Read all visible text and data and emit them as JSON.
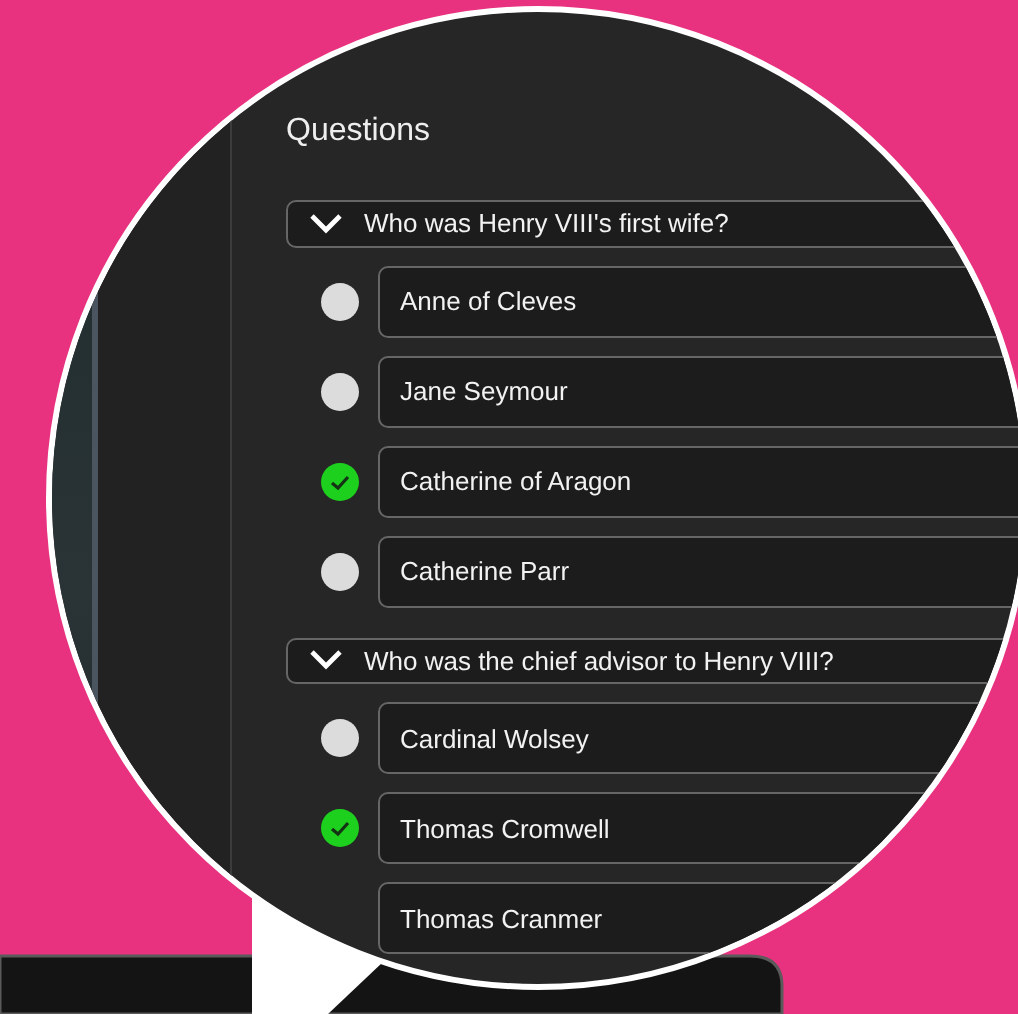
{
  "panel": {
    "title": "Questions"
  },
  "questions": [
    {
      "text": "Who was Henry VIII's first wife?",
      "expanded": true,
      "answers": [
        {
          "text": "Anne of Cleves",
          "selected": false
        },
        {
          "text": "Jane Seymour",
          "selected": false
        },
        {
          "text": "Catherine of Aragon",
          "selected": true
        },
        {
          "text": "Catherine Parr",
          "selected": false
        }
      ]
    },
    {
      "text": "Who was the chief advisor to Henry VIII?",
      "expanded": true,
      "answers": [
        {
          "text": "Cardinal Wolsey",
          "selected": false
        },
        {
          "text": "Thomas Cromwell",
          "selected": true
        },
        {
          "text": "Thomas Cranmer"
        }
      ]
    }
  ]
}
